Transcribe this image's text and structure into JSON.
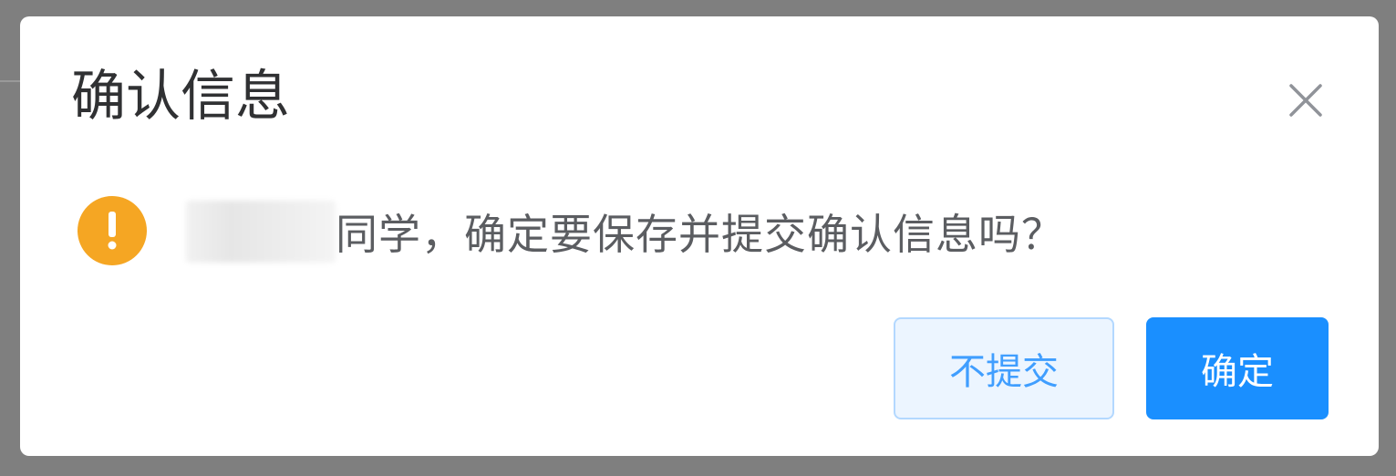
{
  "dialog": {
    "title": "确认信息",
    "message": "同学，确定要保存并提交确认信息吗？",
    "cancel_label": "不提交",
    "confirm_label": "确定",
    "close_icon": "close-icon",
    "status_icon": "warning-icon"
  },
  "colors": {
    "warning": "#f5a623",
    "primary": "#1a8fff",
    "cancel_bg": "#ecf5ff",
    "cancel_text": "#409eff",
    "overlay": "#7f7f7f"
  }
}
